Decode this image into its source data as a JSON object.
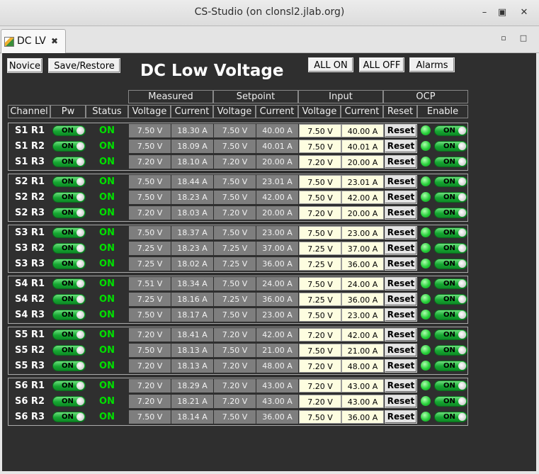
{
  "window": {
    "title": "CS-Studio  (on clonsl2.jlab.org)"
  },
  "tab": {
    "label": "DC LV"
  },
  "buttons": {
    "novice": "Novice",
    "save_restore": "Save/Restore",
    "all_on": "ALL ON",
    "all_off": "ALL OFF",
    "alarms": "Alarms"
  },
  "heading": "DC Low Voltage",
  "groups": {
    "measured": "Measured",
    "setpoint": "Setpoint",
    "input": "Input",
    "ocp": "OCP"
  },
  "columns": {
    "channel": "Channel",
    "pw": "Pw",
    "status": "Status",
    "voltage": "Voltage",
    "current": "Current",
    "reset": "Reset",
    "enable": "Enable"
  },
  "switch_label": "ON",
  "reset_label": "Reset",
  "status_label": "ON",
  "colors": {
    "status_on": "#00e000",
    "led_on": "#27d03a",
    "switch_on": "#16a832",
    "input_bg": "#fdfde0",
    "measured_bg": "#7e7e7e"
  },
  "sectors": [
    {
      "rows": [
        {
          "ch": "S1 R1",
          "mv": "7.50 V",
          "mc": "18.30 A",
          "sv": "7.50 V",
          "sc": "40.00 A",
          "iv": "7.50 V",
          "ic": "40.00 A"
        },
        {
          "ch": "S1 R2",
          "mv": "7.50 V",
          "mc": "18.09 A",
          "sv": "7.50 V",
          "sc": "40.01 A",
          "iv": "7.50 V",
          "ic": "40.01 A"
        },
        {
          "ch": "S1 R3",
          "mv": "7.20 V",
          "mc": "18.10 A",
          "sv": "7.20 V",
          "sc": "20.00 A",
          "iv": "7.20 V",
          "ic": "20.00 A"
        }
      ]
    },
    {
      "rows": [
        {
          "ch": "S2 R1",
          "mv": "7.50 V",
          "mc": "18.44 A",
          "sv": "7.50 V",
          "sc": "23.01 A",
          "iv": "7.50 V",
          "ic": "23.01 A"
        },
        {
          "ch": "S2 R2",
          "mv": "7.50 V",
          "mc": "18.23 A",
          "sv": "7.50 V",
          "sc": "42.00 A",
          "iv": "7.50 V",
          "ic": "42.00 A"
        },
        {
          "ch": "S2 R3",
          "mv": "7.20 V",
          "mc": "18.03 A",
          "sv": "7.20 V",
          "sc": "20.00 A",
          "iv": "7.20 V",
          "ic": "20.00 A"
        }
      ]
    },
    {
      "rows": [
        {
          "ch": "S3 R1",
          "mv": "7.50 V",
          "mc": "18.37 A",
          "sv": "7.50 V",
          "sc": "23.00 A",
          "iv": "7.50 V",
          "ic": "23.00 A"
        },
        {
          "ch": "S3 R2",
          "mv": "7.25 V",
          "mc": "18.23 A",
          "sv": "7.25 V",
          "sc": "37.00 A",
          "iv": "7.25 V",
          "ic": "37.00 A"
        },
        {
          "ch": "S3 R3",
          "mv": "7.25 V",
          "mc": "18.02 A",
          "sv": "7.25 V",
          "sc": "36.00 A",
          "iv": "7.25 V",
          "ic": "36.00 A"
        }
      ]
    },
    {
      "rows": [
        {
          "ch": "S4 R1",
          "mv": "7.51 V",
          "mc": "18.34 A",
          "sv": "7.50 V",
          "sc": "24.00 A",
          "iv": "7.50 V",
          "ic": "24.00 A"
        },
        {
          "ch": "S4 R2",
          "mv": "7.25 V",
          "mc": "18.16 A",
          "sv": "7.25 V",
          "sc": "36.00 A",
          "iv": "7.25 V",
          "ic": "36.00 A"
        },
        {
          "ch": "S4 R3",
          "mv": "7.50 V",
          "mc": "18.17 A",
          "sv": "7.50 V",
          "sc": "23.00 A",
          "iv": "7.50 V",
          "ic": "23.00 A"
        }
      ]
    },
    {
      "rows": [
        {
          "ch": "S5 R1",
          "mv": "7.20 V",
          "mc": "18.41 A",
          "sv": "7.20 V",
          "sc": "42.00 A",
          "iv": "7.20 V",
          "ic": "42.00 A"
        },
        {
          "ch": "S5 R2",
          "mv": "7.50 V",
          "mc": "18.13 A",
          "sv": "7.50 V",
          "sc": "21.00 A",
          "iv": "7.50 V",
          "ic": "21.00 A"
        },
        {
          "ch": "S5 R3",
          "mv": "7.20 V",
          "mc": "18.13 A",
          "sv": "7.20 V",
          "sc": "48.00 A",
          "iv": "7.20 V",
          "ic": "48.00 A"
        }
      ]
    },
    {
      "rows": [
        {
          "ch": "S6 R1",
          "mv": "7.20 V",
          "mc": "18.29 A",
          "sv": "7.20 V",
          "sc": "43.00 A",
          "iv": "7.20 V",
          "ic": "43.00 A"
        },
        {
          "ch": "S6 R2",
          "mv": "7.20 V",
          "mc": "18.21 A",
          "sv": "7.20 V",
          "sc": "43.00 A",
          "iv": "7.20 V",
          "ic": "43.00 A"
        },
        {
          "ch": "S6 R3",
          "mv": "7.50 V",
          "mc": "18.14 A",
          "sv": "7.50 V",
          "sc": "36.00 A",
          "iv": "7.50 V",
          "ic": "36.00 A"
        }
      ]
    }
  ]
}
